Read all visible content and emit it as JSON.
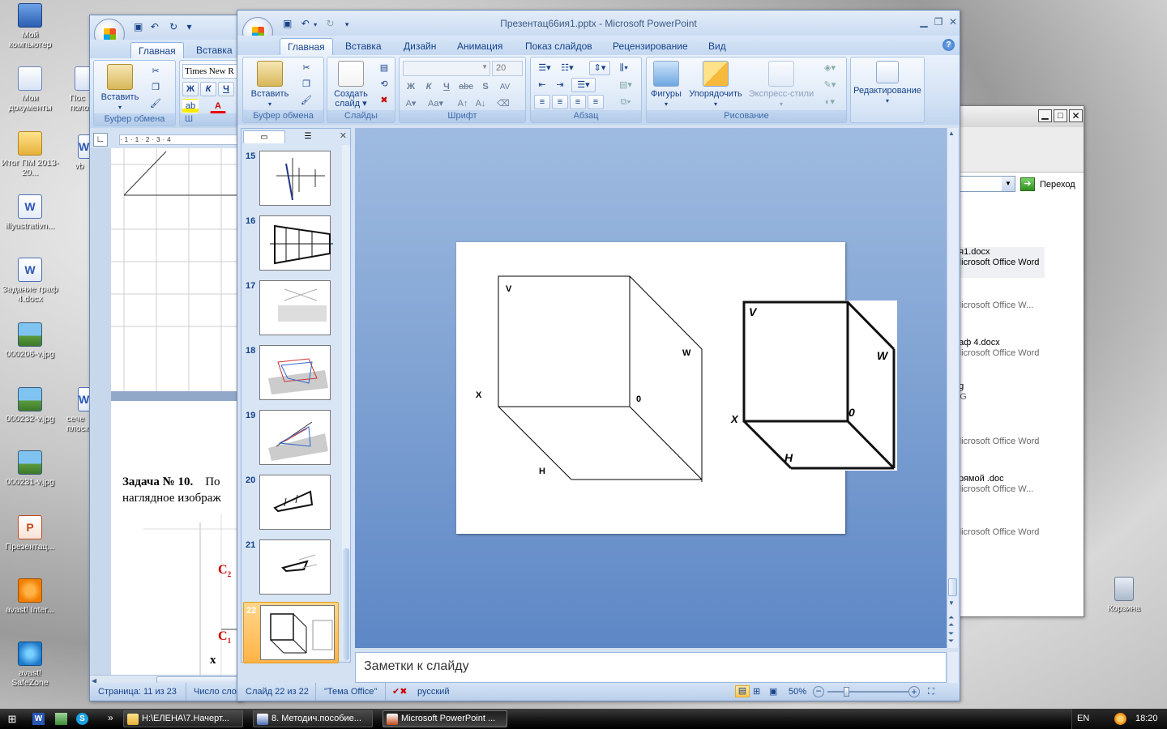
{
  "desktop": {
    "icons": [
      {
        "label": "Мой компьютер",
        "icon": "computer-icon"
      },
      {
        "label": "Мои документы",
        "icon": "documents-icon"
      },
      {
        "label": "Итог ПМ 2013-20...",
        "icon": "folder-icon"
      },
      {
        "label": "illyustrativn...",
        "icon": "word-doc-icon"
      },
      {
        "label": "Задание граф 4.docx",
        "icon": "word-doc-icon"
      },
      {
        "label": "000206-v.jpg",
        "icon": "image-icon"
      },
      {
        "label": "000232-v.jpg",
        "icon": "image-icon"
      },
      {
        "label": "000231-v.jpg",
        "icon": "image-icon"
      },
      {
        "label": "Презентац...",
        "icon": "powerpoint-icon"
      },
      {
        "label": "avast! Inter...",
        "icon": "avast-icon"
      },
      {
        "label": "avast! SafeZone",
        "icon": "safezone-icon"
      }
    ],
    "partial_icons": [
      "Пос полож",
      "vb",
      "сече плоск"
    ],
    "trash": "Корзина"
  },
  "word": {
    "tabs": [
      "Главная",
      "Вставка"
    ],
    "font_name": "Times New R",
    "paste": "Вставить",
    "clipboard_label": "Буфер обмена",
    "text": {
      "task": "Задача № 10.",
      "task_rest": "По",
      "line2": "наглядное изображ"
    },
    "labels": {
      "c2": "C",
      "c2sub": "2",
      "c1": "C",
      "c1sub": "1",
      "x": "x"
    },
    "status": {
      "page": "Страница: 11 из 23",
      "words": "Число сло"
    }
  },
  "ppt": {
    "title": "Презентац66ия1.pptx - Microsoft PowerPoint",
    "tabs": [
      "Главная",
      "Вставка",
      "Дизайн",
      "Анимация",
      "Показ слайдов",
      "Рецензирование",
      "Вид"
    ],
    "groups": {
      "clipboard": {
        "label": "Буфер обмена",
        "paste": "Вставить"
      },
      "slides": {
        "label": "Слайды",
        "create": "Создать",
        "create2": "слайд"
      },
      "font": {
        "label": "Шрифт",
        "size": "20",
        "bold": "Ж",
        "italic": "К",
        "underline": "Ч",
        "strike": "abc",
        "shadow": "S",
        "spacing": "AV"
      },
      "paragraph": {
        "label": "Абзац"
      },
      "drawing": {
        "label": "Рисование",
        "shapes": "Фигуры",
        "arrange": "Упорядочить",
        "styles": "Экспресс-стили"
      },
      "editing": {
        "label": "Редактирование"
      }
    },
    "thumbnails": [
      "15",
      "16",
      "17",
      "18",
      "19",
      "20",
      "21",
      "22"
    ],
    "selected": "22",
    "slide": {
      "v": "V",
      "w": "W",
      "x": "X",
      "o": "0",
      "h": "H"
    },
    "scan": {
      "v": "V",
      "w": "W",
      "x": "X",
      "o": "0",
      "h": "H"
    },
    "notes": "Заметки к слайду",
    "status": {
      "slide": "Слайд 22 из 22",
      "theme": "\"Тема Office\"",
      "lang": "русский",
      "zoom": "50%"
    }
  },
  "explorer": {
    "go": "Переход",
    "files": [
      {
        "name": "ия1.docx",
        "type": "Microsoft Office Word"
      },
      {
        "name": "",
        "type": "Microsoft Office W..."
      },
      {
        "name": "раф 4.docx",
        "type": "Microsoft Office Word"
      },
      {
        "name": "pg",
        "type": "EG"
      },
      {
        "name": "",
        "type": "Microsoft Office Word"
      },
      {
        "name": "прямой .doc",
        "type": "Microsoft Office W..."
      },
      {
        "name": "",
        "type": "Microsoft Office Word"
      }
    ]
  },
  "taskbar": {
    "items": [
      {
        "label": "H:\\ЕЛЕНА\\7.Начерт...",
        "icon": "folder-icon"
      },
      {
        "label": "8. Методич.пособие...",
        "icon": "word-doc-icon"
      },
      {
        "label": "Microsoft PowerPoint ...",
        "icon": "powerpoint-icon"
      }
    ],
    "lang": "EN",
    "time": "18:20"
  }
}
